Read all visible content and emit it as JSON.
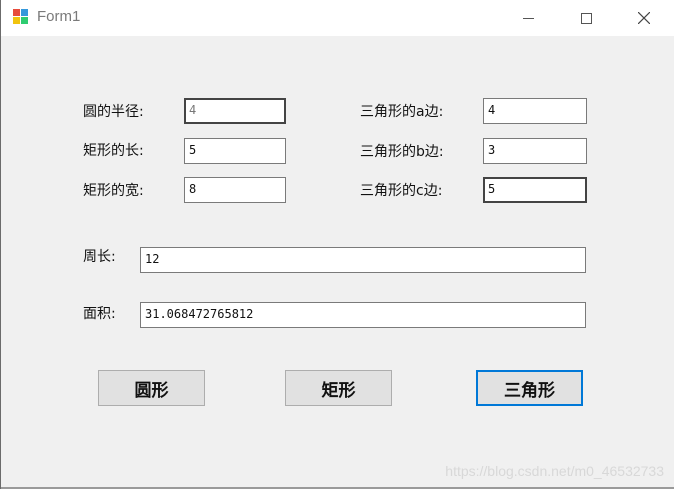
{
  "window": {
    "title": "Form1"
  },
  "labels": {
    "circle_radius": "圆的半径:",
    "rect_length": "矩形的长:",
    "rect_width": "矩形的宽:",
    "tri_a": "三角形的a边:",
    "tri_b": "三角形的b边:",
    "tri_c": "三角形的c边:",
    "perimeter": "周长:",
    "area": "面积:"
  },
  "fields": {
    "circle_radius": "4",
    "rect_length": "5",
    "rect_width": "8",
    "tri_a": "4",
    "tri_b": "3",
    "tri_c": "5",
    "perimeter": "12",
    "area": "31.068472765812"
  },
  "buttons": {
    "circle": "圆形",
    "rectangle": "矩形",
    "triangle": "三角形"
  },
  "watermark": "https://blog.csdn.net/m0_46532733",
  "colors": {
    "accent": "#0078d7"
  }
}
